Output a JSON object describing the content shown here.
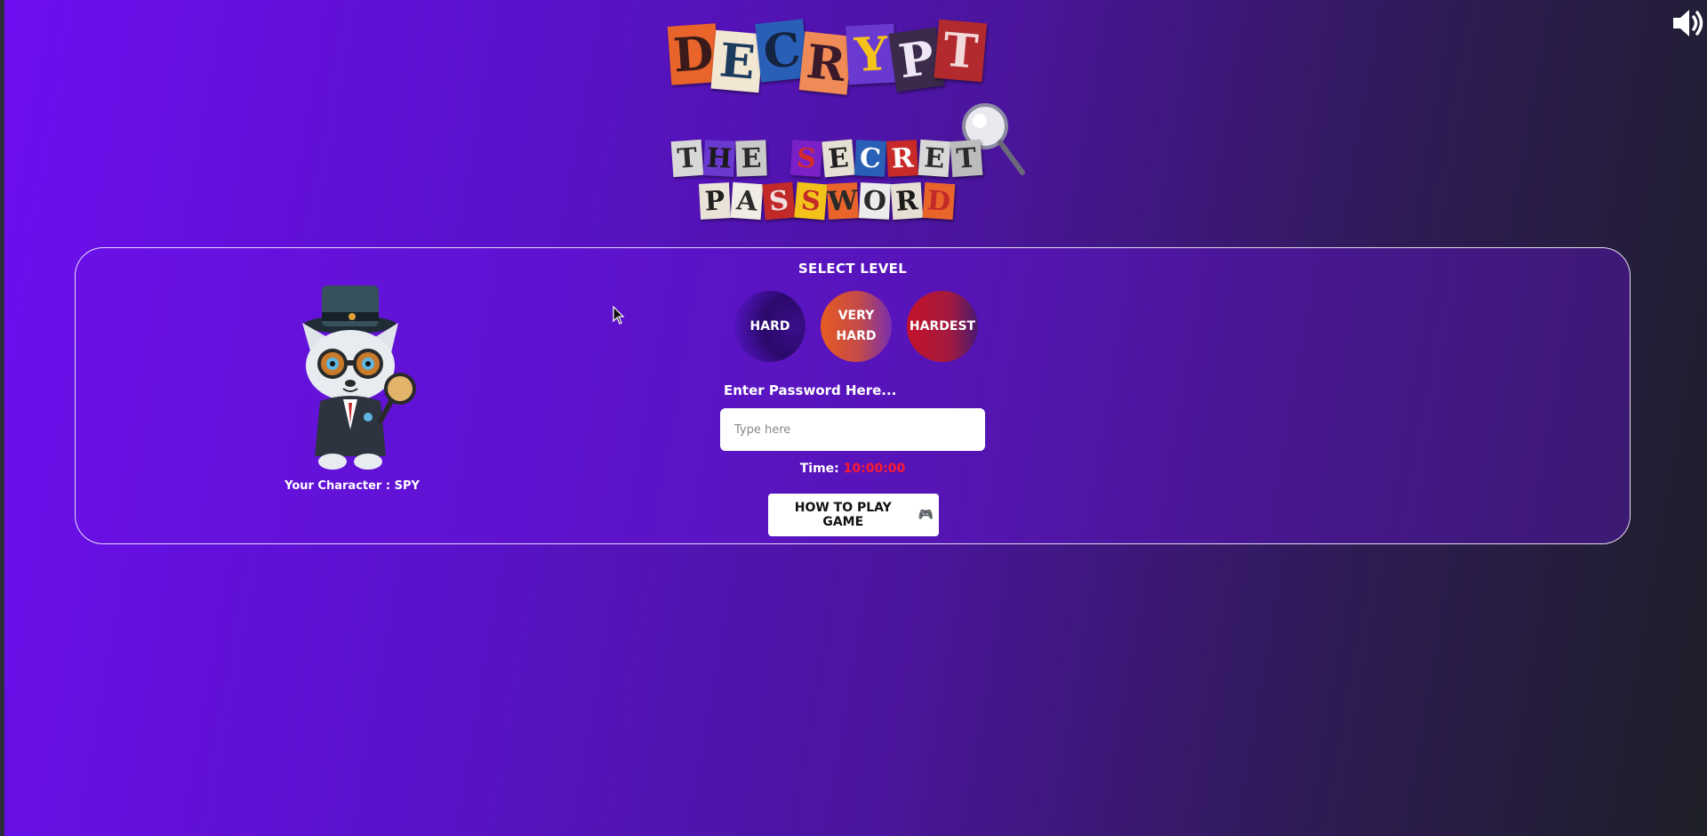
{
  "logo": {
    "title_letters": [
      "D",
      "E",
      "C",
      "R",
      "Y",
      "P",
      "T"
    ],
    "subtitle_line1": [
      "T",
      "H",
      "E",
      " ",
      "S",
      "E",
      "C",
      "R",
      "E",
      "T"
    ],
    "subtitle_line2": [
      "P",
      "A",
      "S",
      "S",
      "W",
      "O",
      "R",
      "D"
    ]
  },
  "sound": {
    "icon": "speaker-volume-icon"
  },
  "character": {
    "label": "Your Character : SPY",
    "image": "spy-cat-detective"
  },
  "level_select": {
    "heading": "SELECT LEVEL",
    "levels": [
      {
        "label": "HARD"
      },
      {
        "label": "VERY HARD"
      },
      {
        "label": "HARDEST"
      }
    ]
  },
  "password": {
    "label": "Enter Password Here...",
    "placeholder": "Type here",
    "value": ""
  },
  "timer": {
    "label": "Time:",
    "value": "10:00:00"
  },
  "how_to_play": {
    "label": "HOW TO PLAY GAME",
    "icon": "🎮"
  },
  "colors": {
    "timer_value": "#ff1a2e",
    "panel_border": "#ffffff"
  }
}
